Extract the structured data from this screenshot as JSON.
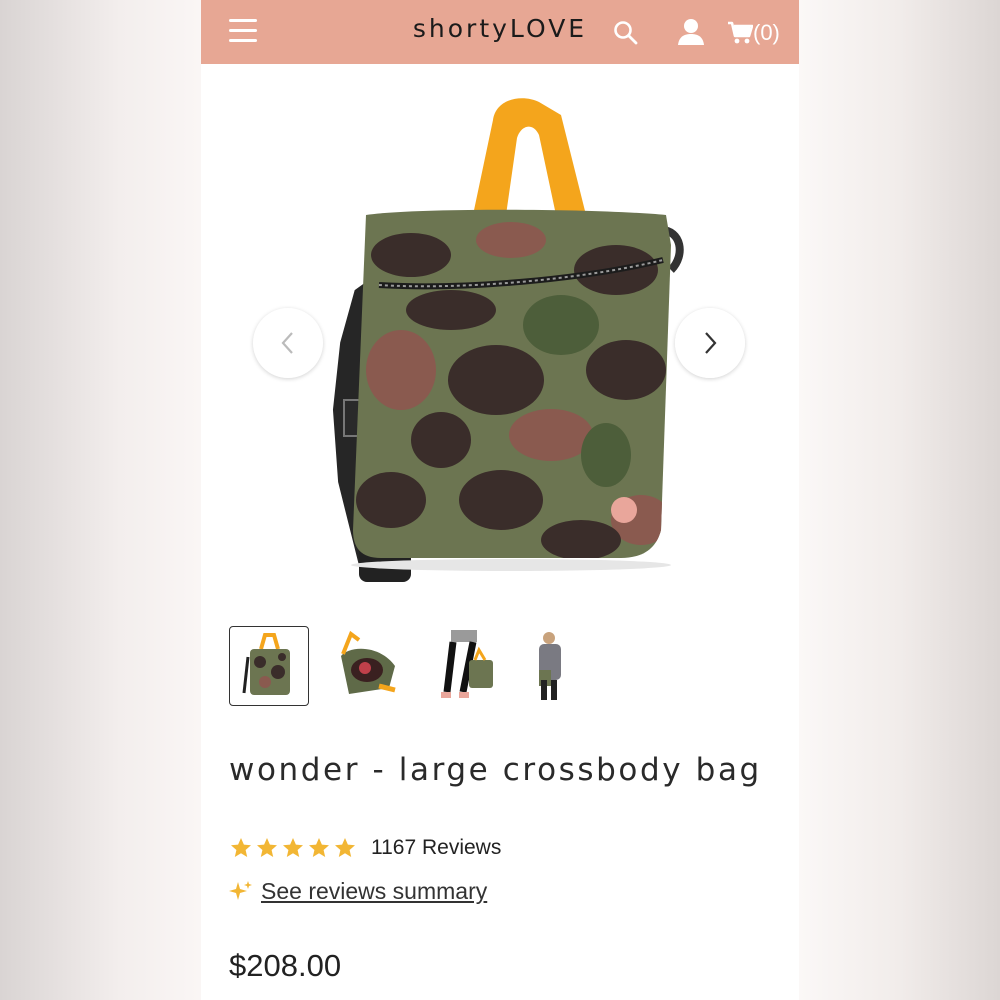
{
  "header": {
    "brand_prefix": "shorty",
    "brand_suffix": "LOVE",
    "cart_count": "(0)",
    "icons": [
      "menu-icon",
      "search-icon",
      "user-icon",
      "cart-icon"
    ],
    "background_color": "#e7a794"
  },
  "gallery": {
    "thumbnail_count": 4,
    "active_thumbnail": 1
  },
  "product": {
    "title": "wonder - large crossbody bag",
    "rating_stars": 5,
    "reviews": "1167 Reviews",
    "summary_link": "See reviews summary",
    "price": "$208.00"
  },
  "colors": {
    "star": "#f2b634",
    "handle": "#f4a51c",
    "camo_base": "#6c7551"
  }
}
